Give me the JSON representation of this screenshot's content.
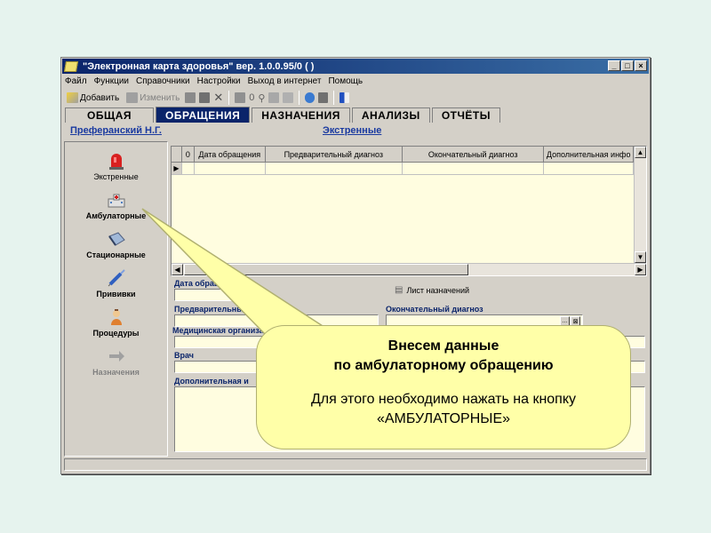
{
  "window": {
    "title": "\"Электронная карта здоровья\" вер. 1.0.0.95/0 ( )",
    "controls": [
      "_",
      "□",
      "×"
    ]
  },
  "menu": [
    "Файл",
    "Функции",
    "Справочники",
    "Настройки",
    "Выход в интернет",
    "Помощь"
  ],
  "toolbar": {
    "add_label": "Добавить",
    "edit_label": "Изменить"
  },
  "tabs": [
    {
      "label": "ОБЩАЯ",
      "active": false
    },
    {
      "label": "ОБРАЩЕНИЯ",
      "active": true
    },
    {
      "label": "НАЗНАЧЕНИЯ",
      "active": false
    },
    {
      "label": "АНАЛИЗЫ",
      "active": false
    },
    {
      "label": "ОТЧЁТЫ",
      "active": false
    }
  ],
  "patient_name": "Преферанский Н.Г.",
  "current_section": "Экстренные",
  "sidebar": [
    {
      "label": "Экстренные",
      "icon": "siren-icon"
    },
    {
      "label": "Амбулаторные",
      "icon": "hospital-icon"
    },
    {
      "label": "Стационарные",
      "icon": "bed-icon"
    },
    {
      "label": "Прививки",
      "icon": "syringe-icon"
    },
    {
      "label": "Процедуры",
      "icon": "doctor-icon"
    },
    {
      "label": "Назначения",
      "icon": "arrow-icon"
    }
  ],
  "grid": {
    "columns": [
      "0",
      "Дата обращения",
      "Предварительный диагноз",
      "Окончательный диагноз",
      "Дополнительная инфо"
    ],
    "row_marker": "▶"
  },
  "form": {
    "date_label": "Дата обращения",
    "list_button": "Лист назначений",
    "prelim_label": "Предварительный диагноз",
    "final_label": "Окончательный диагноз",
    "org_label": "Медицинская организац",
    "doctor_label": "Врач",
    "extra_label": "Дополнительная и"
  },
  "callout": {
    "line1": "Внесем данные",
    "line2": "по амбулаторному обращению",
    "line3": "Для этого необходимо нажать на кнопку",
    "line4": "«АМБУЛАТОРНЫЕ»"
  },
  "colors": {
    "background": "#e6f3ee",
    "titlebar": "#0a246a",
    "callout": "#ffffa8",
    "label_blue": "#1a3aa0"
  }
}
